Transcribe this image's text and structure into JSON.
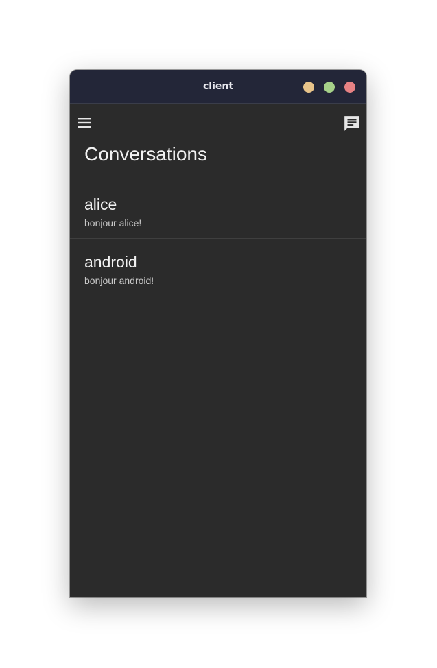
{
  "window": {
    "title": "client",
    "controls": {
      "minimize_color": "#e8c48a",
      "maximize_color": "#a6d189",
      "close_color": "#e78284"
    }
  },
  "appbar": {
    "menu_icon": "hamburger-menu-icon",
    "new_chat_icon": "chat-message-icon"
  },
  "page": {
    "title": "Conversations"
  },
  "conversations": [
    {
      "name": "alice",
      "preview": "bonjour alice!"
    },
    {
      "name": "android",
      "preview": "bonjour android!"
    }
  ],
  "colors": {
    "titlebar_bg": "#232638",
    "app_bg": "#2b2b2b",
    "text_primary": "#f2f2f2",
    "text_secondary": "#c8c8c8"
  }
}
